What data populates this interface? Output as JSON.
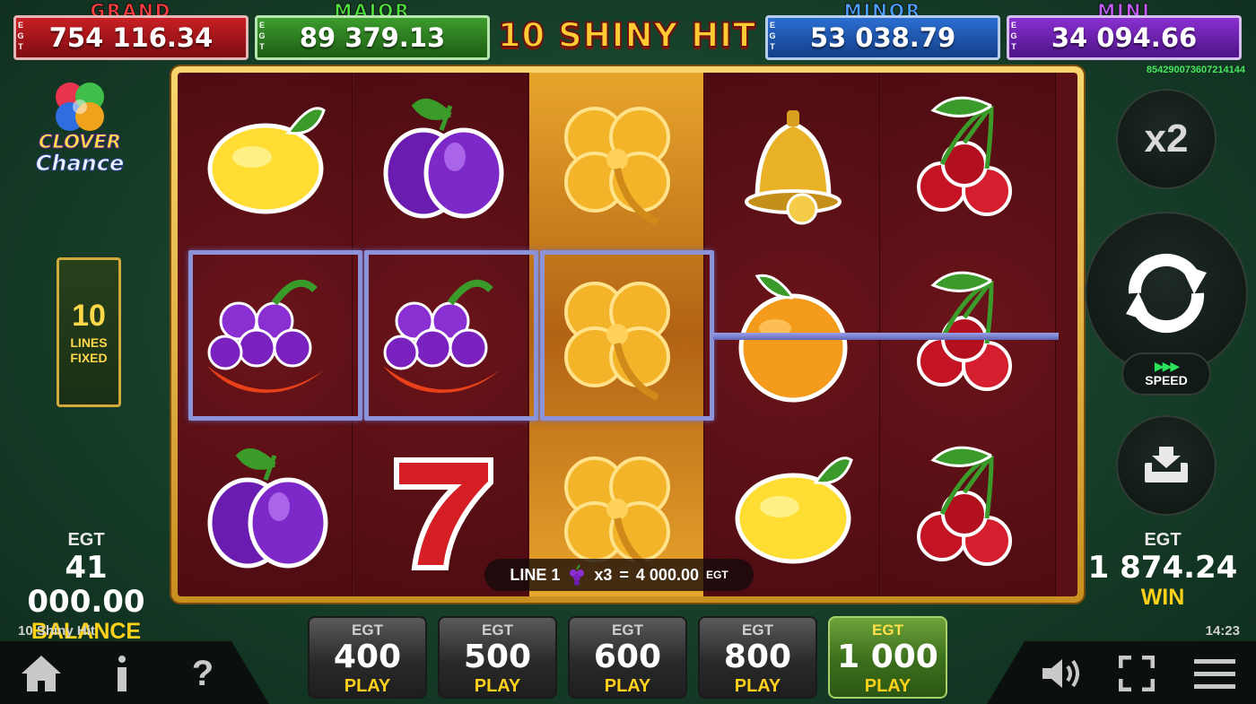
{
  "jackpots": [
    {
      "name": "GRAND",
      "value": "754 116.34",
      "currency": "EGT"
    },
    {
      "name": "MAJOR",
      "value": "89 379.13",
      "currency": "EGT"
    },
    {
      "name": "MINOR",
      "value": "53 038.79",
      "currency": "EGT"
    },
    {
      "name": "MINI",
      "value": "34 094.66",
      "currency": "EGT"
    }
  ],
  "game_title": "10 SHINY HIT",
  "serial_number": "854290073607214144",
  "logo": {
    "line1": "CLOVER",
    "line2": "Chance"
  },
  "lines": {
    "count": "10",
    "label1": "LINES",
    "label2": "FIXED"
  },
  "reels": [
    [
      "lemon",
      "grapes",
      "plum"
    ],
    [
      "plum",
      "grapes",
      "seven"
    ],
    [
      "gold-clover",
      "gold-clover",
      "gold-clover"
    ],
    [
      "bell",
      "orange",
      "lemon"
    ],
    [
      "cherry",
      "cherry",
      "cherry"
    ]
  ],
  "line_win": {
    "line": "LINE 1",
    "symbol": "grapes",
    "multiplier": "x3",
    "equals": "=",
    "amount": "4 000.00",
    "currency": "EGT"
  },
  "controls": {
    "multiplier": "x2",
    "speed_label": "SPEED",
    "speed_arrows": "▶▶▶"
  },
  "balance": {
    "currency": "EGT",
    "value": "41 000.00",
    "label": "BALANCE"
  },
  "win": {
    "currency": "EGT",
    "value": "1 874.24",
    "label": "WIN"
  },
  "game_name": "10 Shiny Hit",
  "clock": "14:23",
  "bets": [
    {
      "currency": "EGT",
      "amount": "400",
      "action": "PLAY",
      "active": false
    },
    {
      "currency": "EGT",
      "amount": "500",
      "action": "PLAY",
      "active": false
    },
    {
      "currency": "EGT",
      "amount": "600",
      "action": "PLAY",
      "active": false
    },
    {
      "currency": "EGT",
      "amount": "800",
      "action": "PLAY",
      "active": false
    },
    {
      "currency": "EGT",
      "amount": "1 000",
      "action": "PLAY",
      "active": true
    }
  ],
  "bottom_icons": {
    "left": [
      "home-icon",
      "info-icon",
      "help-icon"
    ],
    "right": [
      "sound-icon",
      "fullscreen-icon",
      "menu-icon"
    ]
  },
  "colors": {
    "grand": "#c81f23",
    "major": "#3c9d2c",
    "minor": "#2a6ed1",
    "mini": "#8a2fd1",
    "accent_yellow": "#ffd11a",
    "win_line": "#8d93d8"
  }
}
